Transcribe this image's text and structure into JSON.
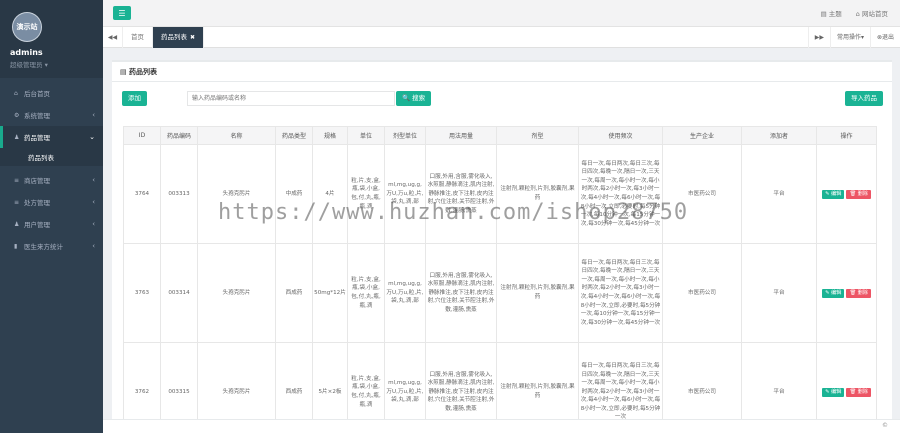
{
  "profile": {
    "avatar_text": "演示站",
    "name": "admins",
    "role": "超级管理员 ▾"
  },
  "menu": [
    {
      "icon": "home-icon",
      "glyph": "⌂",
      "label": "后台首页"
    },
    {
      "icon": "gear-icon",
      "glyph": "⚙",
      "label": "系统管理"
    },
    {
      "icon": "user-icon",
      "glyph": "♟",
      "label": "药品管理"
    },
    {
      "icon": "list-icon",
      "glyph": "≡",
      "label": "商店管理"
    },
    {
      "icon": "list-icon",
      "glyph": "≡",
      "label": "处方管理"
    },
    {
      "icon": "user-icon",
      "glyph": "♟",
      "label": "用户管理"
    },
    {
      "icon": "chart-icon",
      "glyph": "▮",
      "label": "医生来方统计"
    }
  ],
  "submenu": {
    "label": "药品列表"
  },
  "topbar": {
    "theme": "▤ 主题",
    "site_home": "⌂ 网站首页"
  },
  "tabs": {
    "prev": "◀◀",
    "home": "首页",
    "active": "药品列表",
    "close": "✖",
    "next": "▶▶",
    "ops": "常用操作▾",
    "exit": "⊗退出"
  },
  "panel": {
    "title": "▤ 药品列表",
    "add": "添加",
    "search_placeholder": "输入药品编码或名称",
    "search_btn": "🔍 搜索",
    "import": "导入药品"
  },
  "table": {
    "headers": [
      "ID",
      "药品编码",
      "名称",
      "药品类型",
      "规格",
      "单位",
      "剂型单位",
      "用法用量",
      "剂型",
      "使用频次",
      "生产企业",
      "添加者",
      "操作"
    ],
    "rows": [
      {
        "id": "3764",
        "code": "003313",
        "name": "头孢克肟片",
        "type": "中成药",
        "spec": "4片",
        "unit": "粒,片,支,盒,瓶,袋,小盒,包,付,丸,瓶,瓶,滴",
        "dose_unit": "ml,mg,ug,g,万U,万u,粒,片,袋,丸,滴,部",
        "usage": "口服,外用,含服,雾化吸入,水煎服,静脉滴注,肌内注射,静脉推注,皮下注射,皮内注射,穴位注射,关节腔注射,外敷,灌肠,熏蒸",
        "form": "注射剂,颗粒剂,片剂,胶囊剂,果药",
        "freq": "每日一次,每日两次,每日三次,每日四次,每晚一次,隔日一次,三天一次,每周一次,每小时一次,每小时两次,每2小时一次,每3小时一次,每4小时一次,每6小时一次,每8小时一次,立即,必要时,每5分钟一次,每10分钟一次,每15分钟一次,每30分钟一次,每45分钟一次",
        "maker": "市医药公司",
        "adder": "平台",
        "edit": "✎ 编辑",
        "del": "🗑 删除"
      },
      {
        "id": "3763",
        "code": "003314",
        "name": "头孢克肟片",
        "type": "西成药",
        "spec": "50mg*12片",
        "unit": "粒,片,支,盒,瓶,袋,小盒,包,付,丸,瓶,瓶,滴",
        "dose_unit": "ml,mg,ug,g,万U,万u,粒,片,袋,丸,滴,部",
        "usage": "口服,外用,含服,雾化吸入,水煎服,静脉滴注,肌内注射,静脉推注,皮下注射,皮内注射,穴位注射,关节腔注射,外敷,灌肠,熏蒸",
        "form": "注射剂,颗粒剂,片剂,胶囊剂,果药",
        "freq": "每日一次,每日两次,每日三次,每日四次,每晚一次,隔日一次,三天一次,每周一次,每小时一次,每小时两次,每2小时一次,每3小时一次,每4小时一次,每6小时一次,每8小时一次,立即,必要时,每5分钟一次,每10分钟一次,每15分钟一次,每30分钟一次,每45分钟一次",
        "maker": "市医药公司",
        "adder": "平台",
        "edit": "✎ 编辑",
        "del": "🗑 删除"
      },
      {
        "id": "3762",
        "code": "003315",
        "name": "头孢克肟片",
        "type": "西成药",
        "spec": "5片×2板",
        "unit": "粒,片,支,盒,瓶,袋,小盒,包,付,丸,瓶,瓶,滴",
        "dose_unit": "ml,mg,ug,g,万U,万u,粒,片,袋,丸,滴,部",
        "usage": "口服,外用,含服,雾化吸入,水煎服,静脉滴注,肌内注射,静脉推注,皮下注射,皮内注射,穴位注射,关节腔注射,外敷,灌肠,熏蒸",
        "form": "注射剂,颗粒剂,片剂,胶囊剂,果药",
        "freq": "每日一次,每日两次,每日三次,每日四次,每晚一次,隔日一次,三天一次,每周一次,每小时一次,每小时两次,每2小时一次,每3小时一次,每4小时一次,每6小时一次,每8小时一次,立即,必要时,每5分钟一次",
        "maker": "市医药公司",
        "adder": "平台",
        "edit": "✎ 编辑",
        "del": "🗑 删除"
      }
    ]
  },
  "footer": {
    "copyright": "©"
  },
  "watermark": "https://www.huzhan.com/ishop28750"
}
